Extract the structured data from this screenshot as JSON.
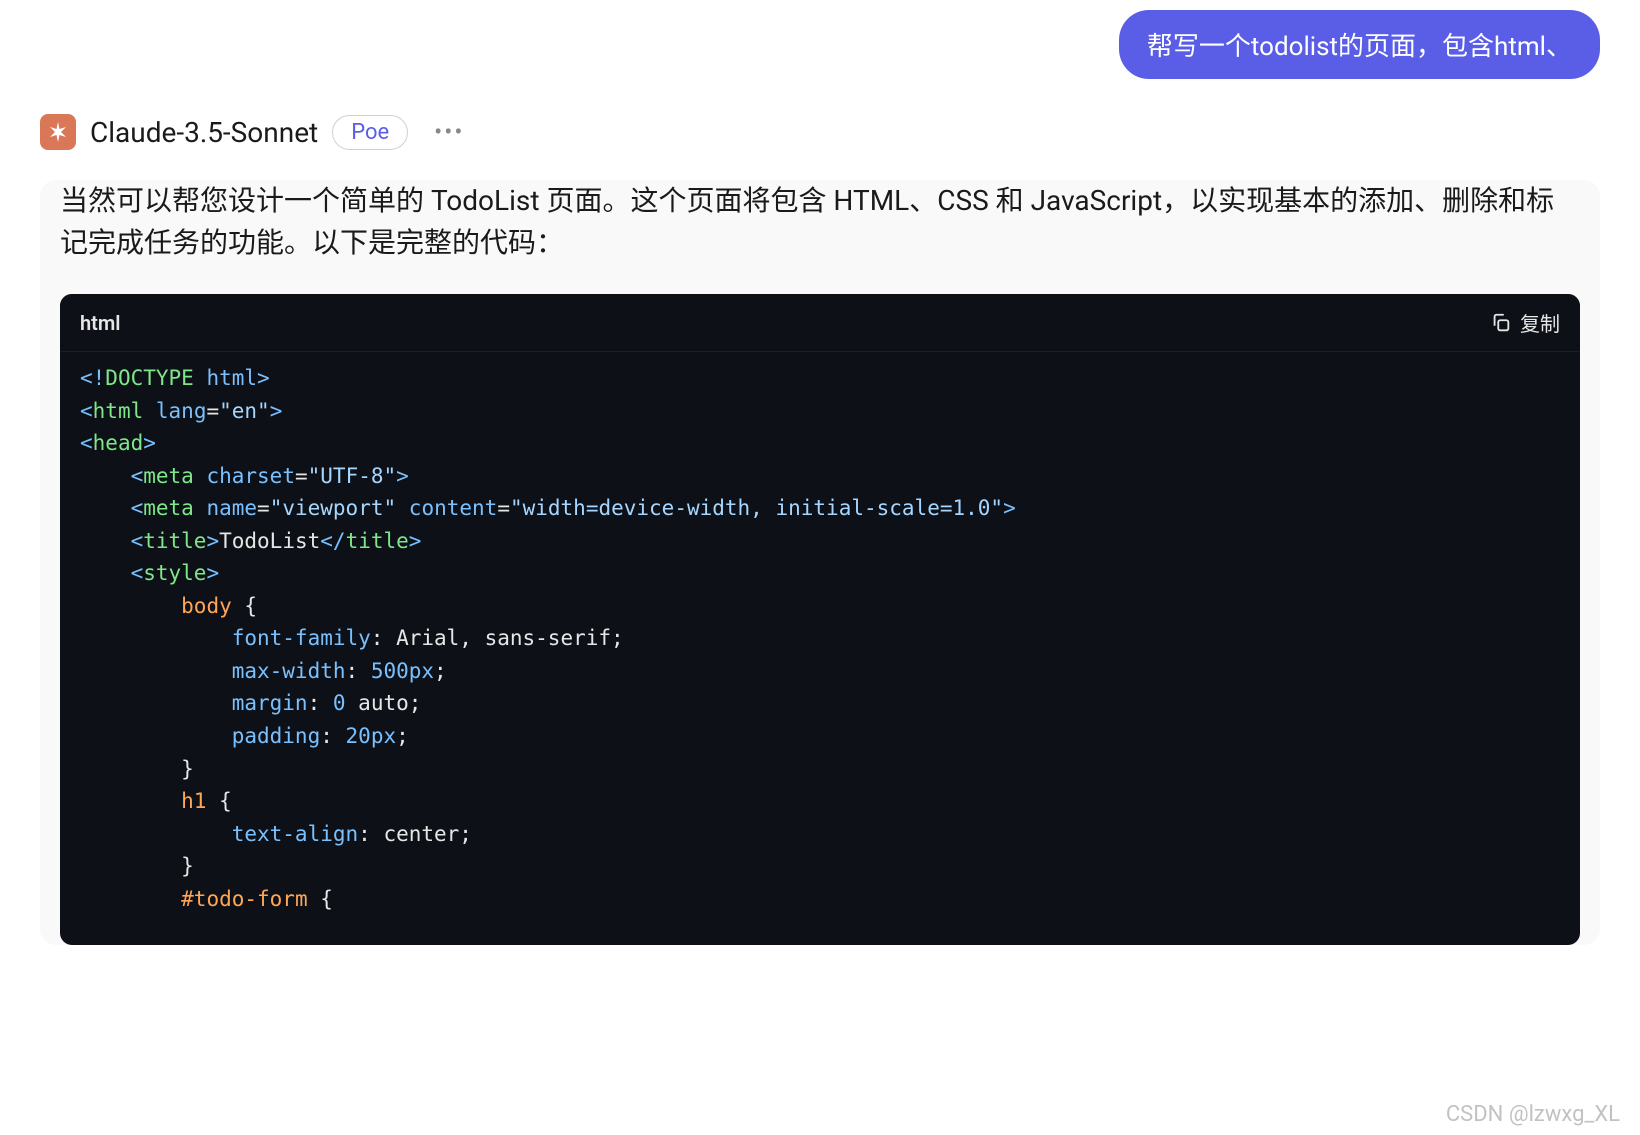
{
  "user_message": "帮写一个todolist的页面，包含html、",
  "assistant": {
    "name": "Claude-3.5-Sonnet",
    "platform_badge": "Poe",
    "avatar_icon": "claude-logo"
  },
  "response_text": "当然可以帮您设计一个简单的 TodoList 页面。这个页面将包含 HTML、CSS 和 JavaScript，以实现基本的添加、删除和标记完成任务的功能。以下是完整的代码：",
  "code_block": {
    "language": "html",
    "copy_label": "复制",
    "content": {
      "doctype": "<!DOCTYPE html>",
      "html_open": "<html lang=\"en\">",
      "head_open": "<head>",
      "meta_charset": "<meta charset=\"UTF-8\">",
      "meta_viewport": "<meta name=\"viewport\" content=\"width=device-width, initial-scale=1.0\">",
      "title": "<title>TodoList</title>",
      "style_open": "<style>",
      "css_body": "body {",
      "css_font_family": "font-family: Arial, sans-serif;",
      "css_max_width": "max-width: 500px;",
      "css_margin": "margin: 0 auto;",
      "css_padding": "padding: 20px;",
      "css_body_close": "}",
      "css_h1": "h1 {",
      "css_text_align": "text-align: center;",
      "css_h1_close": "}",
      "css_todo_form": "#todo-form {"
    }
  },
  "watermark": "CSDN @lzwxg_XL"
}
